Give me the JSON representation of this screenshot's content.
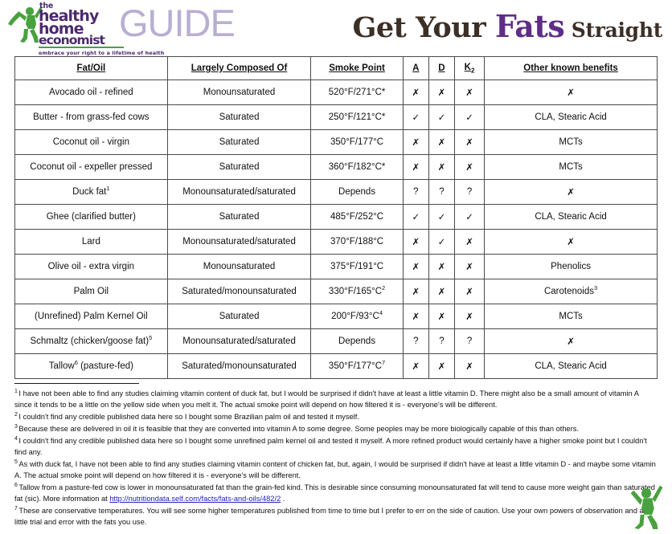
{
  "header": {
    "logo": {
      "the": "the",
      "healthy": "healthy",
      "home": "home",
      "economist": "economist",
      "tagline": "embrace your right to a lifetime of health"
    },
    "guide_word": "GUIDE",
    "title_part1": "Get Your ",
    "title_highlight": "Fats",
    "title_part2": " Straight",
    "colors": {
      "logo_purple": "#4c2a6e",
      "logo_green": "#49a13f",
      "guide_lavender": "#b9aed2",
      "title_dark": "#3b2f26",
      "title_purple": "#5f2d86",
      "link_blue": "#2020c0"
    }
  },
  "table": {
    "columns": [
      "Fat/Oil",
      "Largely Composed Of",
      "Smoke Point",
      "A",
      "D",
      "K",
      "Other known benefits"
    ],
    "k_subscript": "2",
    "rows": [
      {
        "fat": "Avocado oil - refined",
        "fat_note": "",
        "composed": "Monounsaturated",
        "smoke": "520°F/271°C*",
        "smoke_note": "",
        "a": "✗",
        "d": "✗",
        "k2": "✗",
        "benefits": "✗",
        "benefits_note": ""
      },
      {
        "fat": "Butter - from grass-fed cows",
        "fat_note": "",
        "composed": "Saturated",
        "smoke": "250°F/121°C*",
        "smoke_note": "",
        "a": "✓",
        "d": "✓",
        "k2": "✓",
        "benefits": "CLA, Stearic Acid",
        "benefits_note": ""
      },
      {
        "fat": "Coconut oil - virgin",
        "fat_note": "",
        "composed": "Saturated",
        "smoke": "350°F/177°C",
        "smoke_note": "",
        "a": "✗",
        "d": "✗",
        "k2": "✗",
        "benefits": "MCTs",
        "benefits_note": ""
      },
      {
        "fat": "Coconut oil - expeller pressed",
        "fat_note": "",
        "composed": "Saturated",
        "smoke": "360°F/182°C*",
        "smoke_note": "",
        "a": "✗",
        "d": "✗",
        "k2": "✗",
        "benefits": "MCTs",
        "benefits_note": ""
      },
      {
        "fat": "Duck fat",
        "fat_note": "1",
        "composed": "Monounsaturated/saturated",
        "smoke": "Depends",
        "smoke_note": "",
        "a": "?",
        "d": "?",
        "k2": "?",
        "benefits": "✗",
        "benefits_note": ""
      },
      {
        "fat": "Ghee (clarified butter)",
        "fat_note": "",
        "composed": "Saturated",
        "smoke": "485°F/252°C",
        "smoke_note": "",
        "a": "✓",
        "d": "✓",
        "k2": "✓",
        "benefits": "CLA, Stearic Acid",
        "benefits_note": ""
      },
      {
        "fat": "Lard",
        "fat_note": "",
        "composed": "Monounsaturated/saturated",
        "smoke": "370°F/188°C",
        "smoke_note": "",
        "a": "✗",
        "d": "✓",
        "k2": "✗",
        "benefits": "✗",
        "benefits_note": ""
      },
      {
        "fat": "Olive oil - extra virgin",
        "fat_note": "",
        "composed": "Monounsaturated",
        "smoke": "375°F/191°C",
        "smoke_note": "",
        "a": "✗",
        "d": "✗",
        "k2": "✗",
        "benefits": "Phenolics",
        "benefits_note": ""
      },
      {
        "fat": "Palm Oil",
        "fat_note": "",
        "composed": "Saturated/monounsaturated",
        "smoke": "330°F/165°C",
        "smoke_note": "2",
        "a": "✗",
        "d": "✗",
        "k2": "✗",
        "benefits": "Carotenoids",
        "benefits_note": "3"
      },
      {
        "fat": "(Unrefined) Palm Kernel Oil",
        "fat_note": "",
        "composed": "Saturated",
        "smoke": "200°F/93°C",
        "smoke_note": "4",
        "a": "✗",
        "d": "✗",
        "k2": "✗",
        "benefits": "MCTs",
        "benefits_note": ""
      },
      {
        "fat": "Schmaltz (chicken/goose fat)",
        "fat_note": "5",
        "composed": "Monounsaturated/saturated",
        "smoke": "Depends",
        "smoke_note": "",
        "a": "?",
        "d": "?",
        "k2": "?",
        "benefits": "✗",
        "benefits_note": ""
      },
      {
        "fat": "Tallow",
        "fat_note": "6",
        "fat_suffix": " (pasture-fed)",
        "composed": "Saturated/monounsaturated",
        "smoke": "350°F/177°C",
        "smoke_note": "7",
        "a": "✗",
        "d": "✗",
        "k2": "✗",
        "benefits": "CLA, Stearic Acid",
        "benefits_note": ""
      }
    ]
  },
  "footnotes": [
    {
      "num": "1",
      "text": "I have not been able to find any studies claiming vitamin content of duck fat, but I would be surprised if didn't have at least a little vitamin D. There might also be a small amount of vitamin A since it tends to be a little on the yellow side when you melt it. The actual smoke point will depend on how filtered it is - everyone's will be different."
    },
    {
      "num": "2",
      "text": "I couldn't find any credible published data here so I bought some Brazilian palm oil and tested it myself."
    },
    {
      "num": "3",
      "text": "Because these are delivered in oil it is feasible that they are converted into vitamin A to some degree. Some peoples may be more biologically capable of this than others."
    },
    {
      "num": "4",
      "text": "I couldn't find any credible published data here so I bought some unrefined palm kernel oil and tested it myself. A more refined product would certainly have a higher smoke point but I couldn't find any."
    },
    {
      "num": "5",
      "text": "As with duck fat, I have not been able to find any studies claiming vitamin content of chicken fat, but, again, I would be surprised if didn't have at least a little vitamin D - and maybe some vitamin A.  The actual smoke point will depend on how filtered it is - everyone's will be different."
    },
    {
      "num": "6",
      "text": "Tallow from a pasture-fed cow is lower in monounsaturated fat than the grain-fed kind. This is desirable since consuming monounsaturated fat will tend to cause more weight gain than saturated fat (sic). More information at ",
      "link": "http://nutritiondata.self.com/facts/fats-and-oils/482/2",
      "text_after": " ."
    },
    {
      "num": "7",
      "text": "These are conservative temperatures. You will see some higher temperatures published from time to time but I prefer to err on the side of caution. Use your own powers of observation and a little trial and error with the fats you use."
    }
  ]
}
